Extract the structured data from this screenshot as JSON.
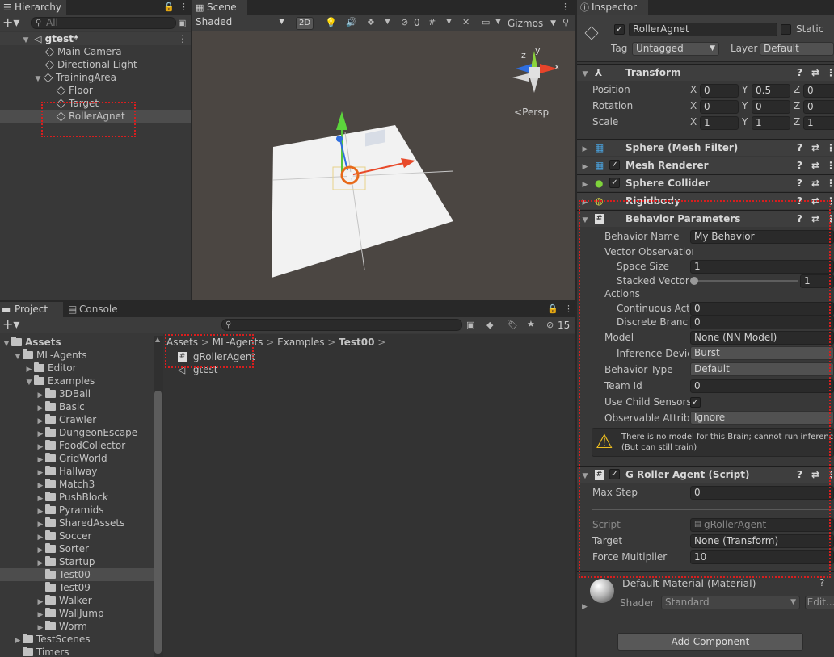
{
  "hierarchy": {
    "tab": "Hierarchy",
    "search_placeholder": "All",
    "scene": "gtest*",
    "items": [
      "Main Camera",
      "Directional Light",
      "TrainingArea",
      "Floor",
      "Target",
      "RollerAgnet"
    ]
  },
  "scene_view": {
    "tab": "Scene",
    "shading": "Shaded",
    "mode_2d": "2D",
    "hidden_count": "0",
    "gizmos": "Gizmos",
    "persp": "Persp",
    "axis_x": "x",
    "axis_y": "y",
    "axis_z": "z"
  },
  "project": {
    "tab_project": "Project",
    "tab_console": "Console",
    "hidden_count": "15",
    "tree": [
      {
        "label": "Assets",
        "depth": 0,
        "expanded": true,
        "bold": true
      },
      {
        "label": "ML-Agents",
        "depth": 1,
        "expanded": true
      },
      {
        "label": "Editor",
        "depth": 2,
        "expanded": false
      },
      {
        "label": "Examples",
        "depth": 2,
        "expanded": true
      },
      {
        "label": "3DBall",
        "depth": 3,
        "expanded": false
      },
      {
        "label": "Basic",
        "depth": 3,
        "expanded": false
      },
      {
        "label": "Crawler",
        "depth": 3,
        "expanded": false
      },
      {
        "label": "DungeonEscape",
        "depth": 3,
        "expanded": false
      },
      {
        "label": "FoodCollector",
        "depth": 3,
        "expanded": false
      },
      {
        "label": "GridWorld",
        "depth": 3,
        "expanded": false
      },
      {
        "label": "Hallway",
        "depth": 3,
        "expanded": false
      },
      {
        "label": "Match3",
        "depth": 3,
        "expanded": false
      },
      {
        "label": "PushBlock",
        "depth": 3,
        "expanded": false
      },
      {
        "label": "Pyramids",
        "depth": 3,
        "expanded": false
      },
      {
        "label": "SharedAssets",
        "depth": 3,
        "expanded": false
      },
      {
        "label": "Soccer",
        "depth": 3,
        "expanded": false
      },
      {
        "label": "Sorter",
        "depth": 3,
        "expanded": false
      },
      {
        "label": "Startup",
        "depth": 3,
        "expanded": false
      },
      {
        "label": "Test00",
        "depth": 3,
        "expanded": null,
        "selected": true
      },
      {
        "label": "Test09",
        "depth": 3,
        "expanded": null
      },
      {
        "label": "Walker",
        "depth": 3,
        "expanded": false
      },
      {
        "label": "WallJump",
        "depth": 3,
        "expanded": false
      },
      {
        "label": "Worm",
        "depth": 3,
        "expanded": false
      },
      {
        "label": "TestScenes",
        "depth": 1,
        "expanded": false
      },
      {
        "label": "Timers",
        "depth": 1,
        "expanded": null
      }
    ],
    "breadcrumb": [
      "Assets",
      "ML-Agents",
      "Examples",
      "Test00"
    ],
    "files": [
      "gRollerAgent",
      "gtest"
    ]
  },
  "inspector": {
    "tab": "Inspector",
    "object_name": "RollerAgnet",
    "static_label": "Static",
    "tag_label": "Tag",
    "tag_value": "Untagged",
    "layer_label": "Layer",
    "layer_value": "Default",
    "transform": {
      "title": "Transform",
      "rows": [
        {
          "label": "Position",
          "x": "0",
          "y": "0.5",
          "z": "0"
        },
        {
          "label": "Rotation",
          "x": "0",
          "y": "0",
          "z": "0"
        },
        {
          "label": "Scale",
          "x": "1",
          "y": "1",
          "z": "1"
        }
      ]
    },
    "components": [
      "Sphere (Mesh Filter)",
      "Mesh Renderer",
      "Sphere Collider",
      "Rigidbody"
    ],
    "behavior": {
      "title": "Behavior Parameters",
      "behavior_name_label": "Behavior Name",
      "behavior_name": "My Behavior",
      "vector_obs_label": "Vector Observation",
      "space_size_label": "Space Size",
      "space_size": "1",
      "stacked_label": "Stacked Vectors",
      "stacked_value": "1",
      "stacked_slider_level": 0,
      "actions_label": "Actions",
      "continuous_label": "Continuous Actions",
      "continuous": "0",
      "discrete_label": "Discrete Branches",
      "discrete": "0",
      "model_label": "Model",
      "model_value": "None (NN Model)",
      "inference_label": "Inference Device",
      "inference_value": "Burst",
      "behavior_type_label": "Behavior Type",
      "behavior_type_value": "Default",
      "team_id_label": "Team Id",
      "team_id": "0",
      "child_sensors_label": "Use Child Sensors",
      "observable_label": "Observable Attribute Handling",
      "observable_value": "Ignore",
      "warning": "There is no model for this Brain; cannot run inference.",
      "warning2": "(But can still train)"
    },
    "agent_script": {
      "title": "G Roller Agent (Script)",
      "max_step_label": "Max Step",
      "max_step": "0",
      "script_label": "Script",
      "script_value": "gRollerAgent",
      "target_label": "Target",
      "target_value": "None (Transform)",
      "force_label": "Force Multiplier",
      "force_value": "10"
    },
    "material": {
      "name": "Default-Material (Material)",
      "shader_label": "Shader",
      "shader_value": "Standard",
      "edit_label": "Edit..."
    },
    "add_component": "Add Component"
  },
  "colors": {
    "highlight_border": "#d81e1e",
    "transform_icon": "#d8d8d8",
    "collider_icon": "#7fd43b",
    "rigidbody_icon": "#d8d34a",
    "grid_icon": "#4aa3df"
  }
}
